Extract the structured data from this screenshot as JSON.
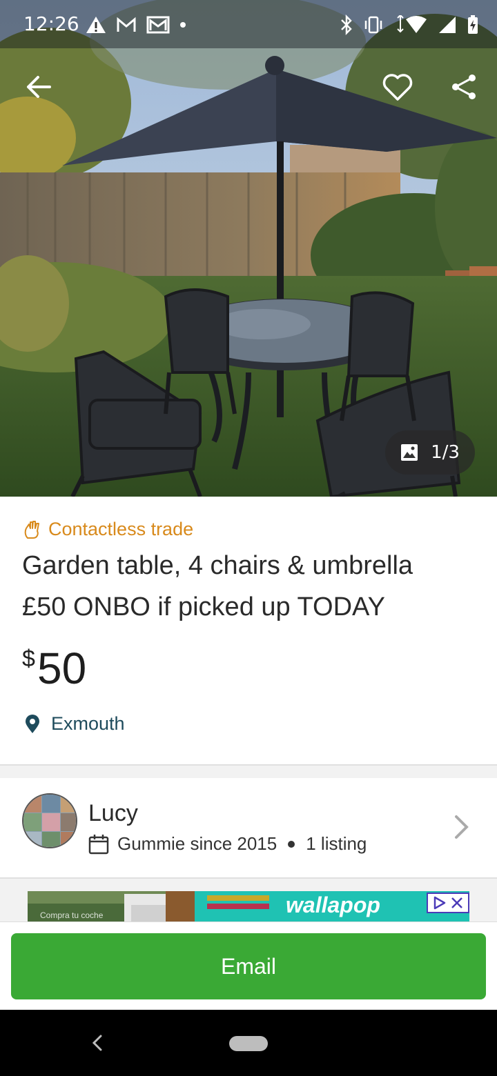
{
  "status_bar": {
    "time": "12:26",
    "left_icons": [
      "warning-icon",
      "gmail-icon",
      "mail-icon",
      "dot-icon"
    ],
    "right_icons": [
      "bluetooth-icon",
      "vibrate-icon",
      "wifi-icon",
      "signal-icon",
      "battery-charging-icon"
    ]
  },
  "hero": {
    "photo_alt": "garden-furniture-photo",
    "counter": "1/3"
  },
  "listing": {
    "badge": "Contactless trade",
    "title_line1": "Garden table, 4 chairs & umbrella",
    "title_line2": "£50 ONBO if picked up TODAY",
    "price_currency": "$",
    "price_amount": "50",
    "location": "Exmouth"
  },
  "seller": {
    "name": "Lucy",
    "since": "Gummie since 2015",
    "listings": "1 listing"
  },
  "ad": {
    "brand": "wallapop",
    "caption": "Compra tu coche"
  },
  "actions": {
    "email_label": "Email"
  },
  "colors": {
    "accent_orange": "#d88a1c",
    "location_teal": "#1e4b5c",
    "button_green": "#3aa935",
    "ad_teal": "#1fc2b3"
  }
}
